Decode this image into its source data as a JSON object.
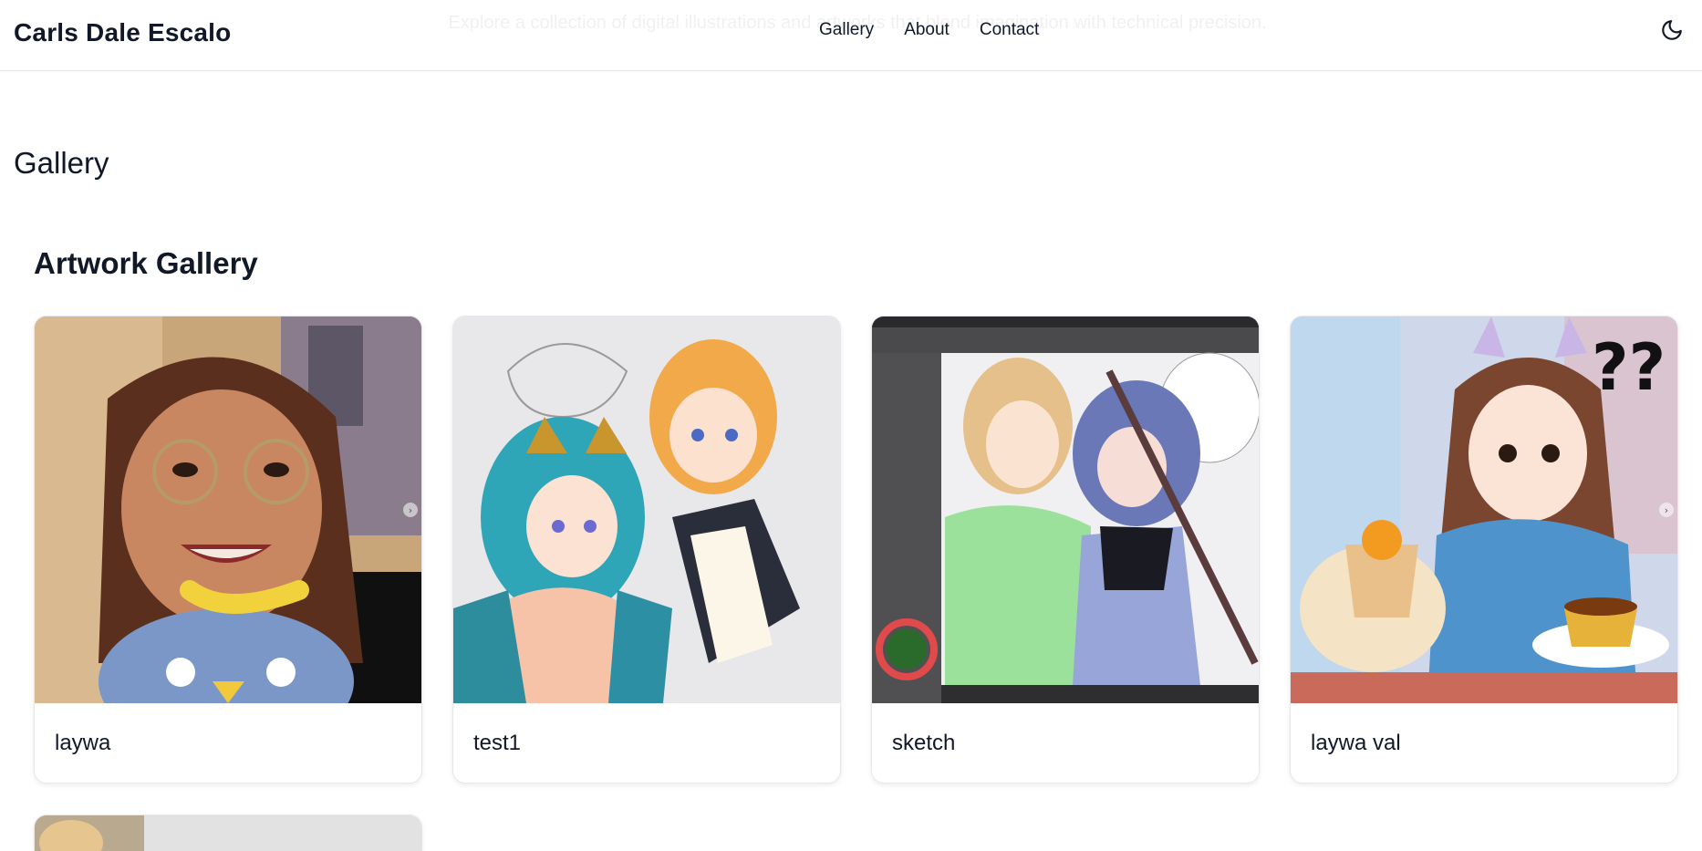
{
  "header": {
    "brand": "Carls Dale Escalo",
    "ghost_text": "Explore a collection of digital illustrations and artworks that blend imagination with technical precision.",
    "nav": [
      {
        "label": "Gallery"
      },
      {
        "label": "About"
      },
      {
        "label": "Contact"
      }
    ],
    "theme_icon": "moon-icon"
  },
  "page": {
    "title": "Gallery",
    "section_title": "Artwork Gallery"
  },
  "cards": [
    {
      "title": "laywa",
      "image": "portrait-selfie-artwork"
    },
    {
      "title": "test1",
      "image": "anime-characters-sketch"
    },
    {
      "title": "sketch",
      "image": "drawing-app-screenshot"
    },
    {
      "title": "laywa val",
      "image": "girl-with-cake-artwork"
    }
  ],
  "colors": {
    "text": "#111827",
    "border": "#e5e7eb",
    "background": "#ffffff"
  }
}
